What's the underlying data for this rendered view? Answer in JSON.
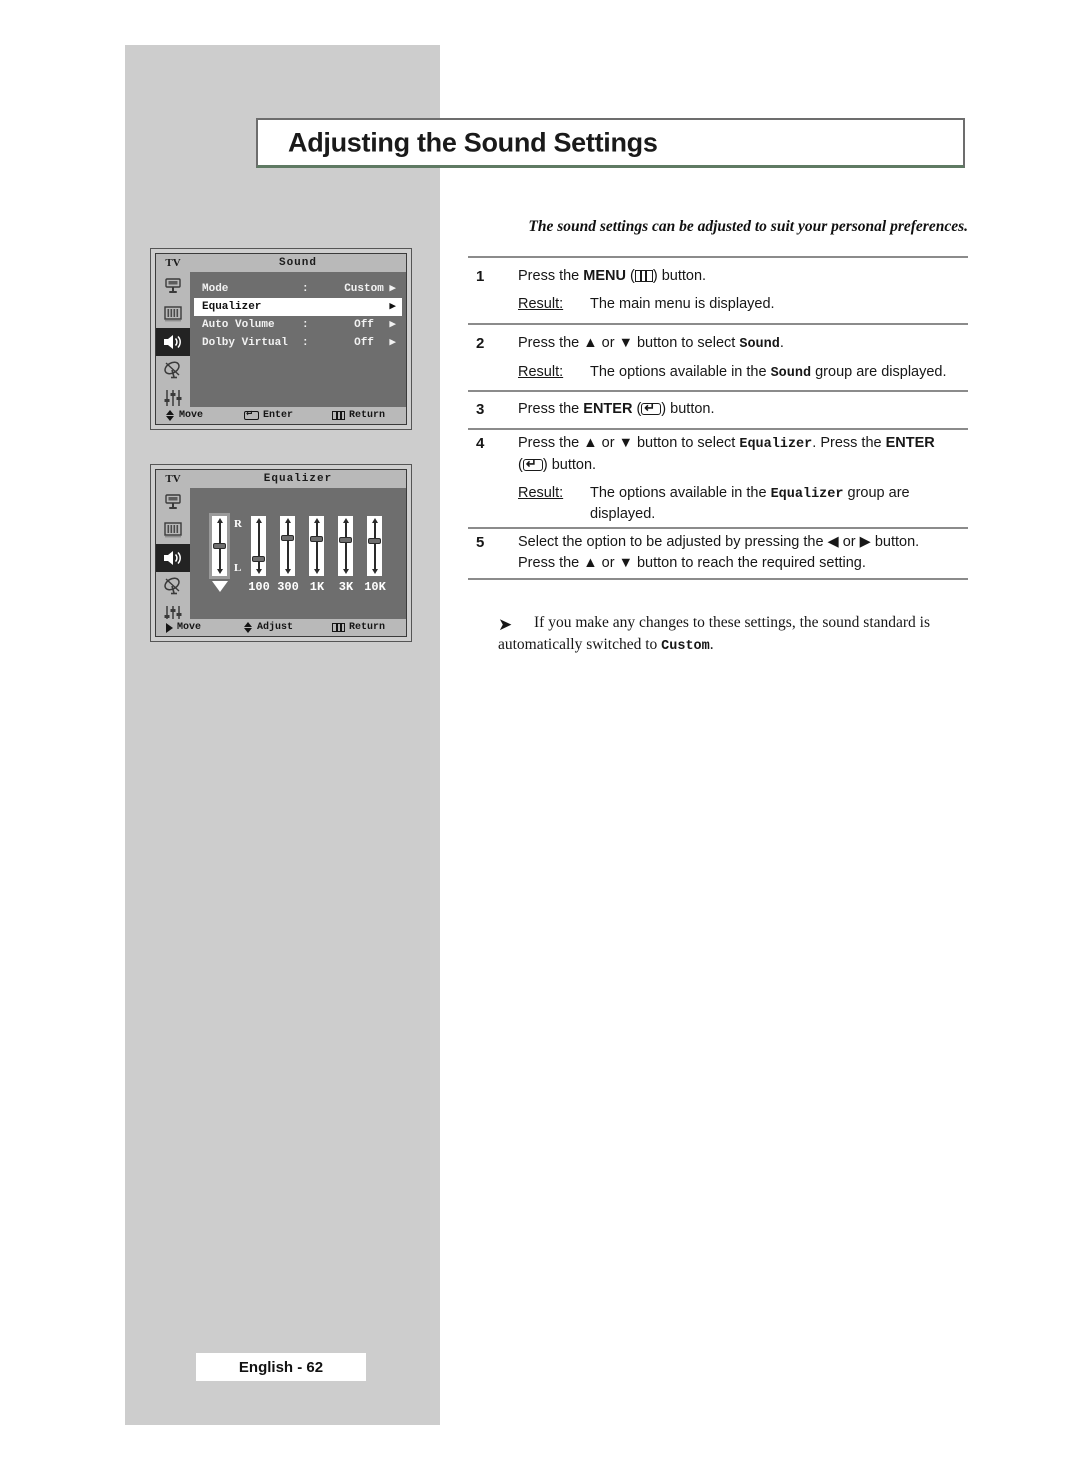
{
  "page": {
    "title": "Adjusting the Sound Settings",
    "intro": "The sound settings can be adjusted to suit your personal preferences.",
    "footer_label": "English - 62"
  },
  "osd_sound": {
    "tv_label": "TV",
    "title": "Sound",
    "sidebar_icons": [
      "input-source-icon",
      "picture-icon",
      "speaker-icon",
      "satellite-dish-icon",
      "setup-sliders-icon"
    ],
    "selected_sidebar_index": 2,
    "rows": [
      {
        "label": "Mode",
        "colon": ":",
        "value": "Custom",
        "arrow": "▶",
        "highlighted": false
      },
      {
        "label": "Equalizer",
        "colon": "",
        "value": "",
        "arrow": "▶",
        "highlighted": true
      },
      {
        "label": "Auto Volume",
        "colon": ":",
        "value": "Off",
        "arrow": "▶",
        "highlighted": false
      },
      {
        "label": "Dolby Virtual",
        "colon": ":",
        "value": "Off",
        "arrow": "▶",
        "highlighted": false
      }
    ],
    "footer": [
      {
        "icon": "up-down-arrows-icon",
        "label": "Move"
      },
      {
        "icon": "enter-button-icon",
        "label": "Enter"
      },
      {
        "icon": "menu-button-icon",
        "label": "Return"
      }
    ]
  },
  "osd_equalizer": {
    "tv_label": "TV",
    "title": "Equalizer",
    "sidebar_icons": [
      "input-source-icon",
      "picture-icon",
      "speaker-icon",
      "satellite-dish-icon",
      "setup-sliders-icon"
    ],
    "selected_sidebar_index": 2,
    "balance": {
      "label": "balance-icon",
      "top_label": "R",
      "bottom_label": "L",
      "position_pct": 50,
      "selected": true
    },
    "bands": [
      {
        "label": "100",
        "position_pct": 72
      },
      {
        "label": "300",
        "position_pct": 37
      },
      {
        "label": "1K",
        "position_pct": 38
      },
      {
        "label": "3K",
        "position_pct": 39
      },
      {
        "label": "10K",
        "position_pct": 40
      }
    ],
    "footer": [
      {
        "icon": "right-arrow-icon",
        "label": "Move"
      },
      {
        "icon": "up-down-arrows-icon",
        "label": "Adjust"
      },
      {
        "icon": "menu-button-icon",
        "label": "Return"
      }
    ]
  },
  "steps": [
    {
      "num": "1",
      "text_before": "Press the ",
      "bold": "MENU",
      "glyph": "menu",
      "text_after": " button.",
      "result_label": "Result:",
      "result_text": "The main menu is displayed."
    },
    {
      "num": "2",
      "text_before": "Press the ▲ or ▼ button to select ",
      "mono": "Sound",
      "text_after": ".",
      "result_label": "Result:",
      "result_before": "The options available in the ",
      "result_mono": "Sound",
      "result_after": " group are displayed."
    },
    {
      "num": "3",
      "text_before": "Press the ",
      "bold": "ENTER",
      "glyph": "enter",
      "text_after": " button."
    },
    {
      "num": "4",
      "text_before": "Press the ▲ or ▼ button to select ",
      "mono": "Equalizer",
      "text_mid": ". Press the ",
      "bold": "ENTER",
      "glyph": "enter",
      "text_after": " button.",
      "result_label": "Result:",
      "result_before": "The options available in the ",
      "result_mono": "Equalizer",
      "result_after": " group are displayed."
    },
    {
      "num": "5",
      "line1": "Select the option to be adjusted by pressing the ◀ or ▶ button.",
      "line2": "Press the ▲ or ▼ button to reach the required setting."
    }
  ],
  "note": {
    "arrow": "➤",
    "text_before": "If you make any changes to these settings, the sound standard is automatically switched to ",
    "mono": "Custom",
    "text_after": "."
  }
}
